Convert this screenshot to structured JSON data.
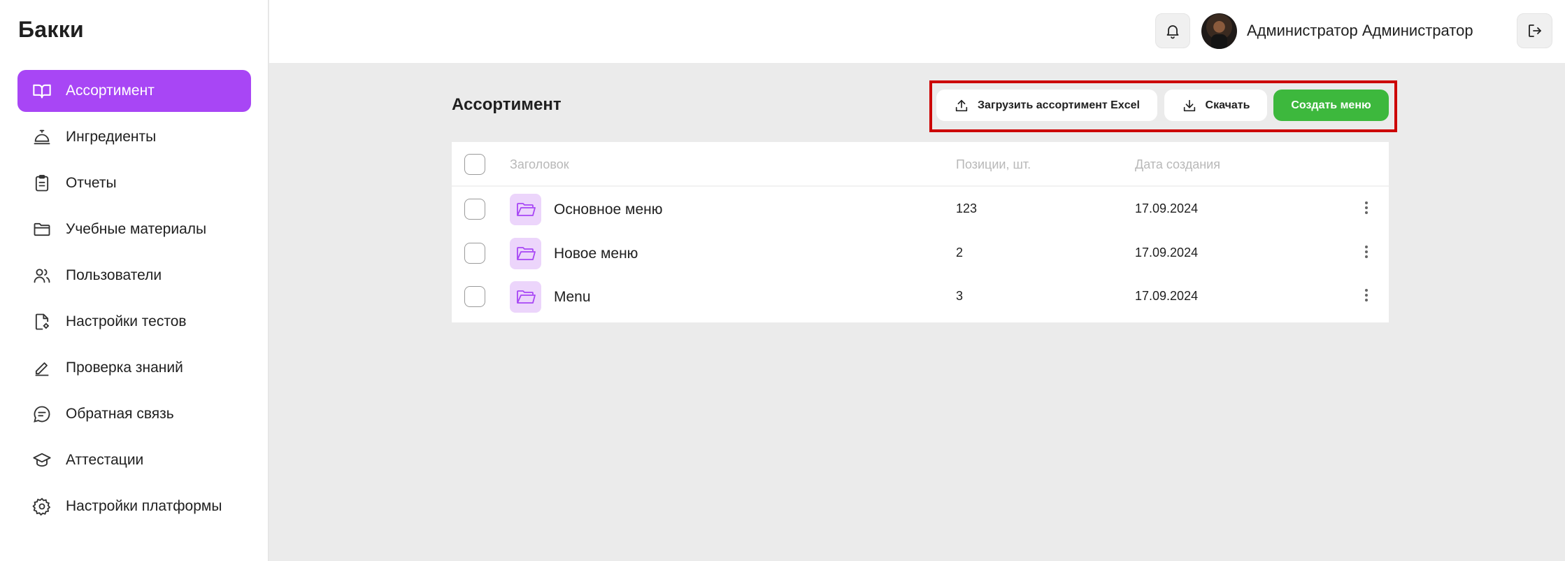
{
  "app": {
    "logo": "Бакки"
  },
  "sidebar": {
    "items": [
      {
        "label": "Ассортимент",
        "icon": "book-open-icon",
        "active": true
      },
      {
        "label": "Ингредиенты",
        "icon": "cloche-icon",
        "active": false
      },
      {
        "label": "Отчеты",
        "icon": "clipboard-icon",
        "active": false
      },
      {
        "label": "Учебные материалы",
        "icon": "folder-icon",
        "active": false
      },
      {
        "label": "Пользователи",
        "icon": "users-icon",
        "active": false
      },
      {
        "label": "Настройки тестов",
        "icon": "file-settings-icon",
        "active": false
      },
      {
        "label": "Проверка знаний",
        "icon": "pen-icon",
        "active": false
      },
      {
        "label": "Обратная связь",
        "icon": "chat-icon",
        "active": false
      },
      {
        "label": "Аттестации",
        "icon": "graduation-cap-icon",
        "active": false
      },
      {
        "label": "Настройки платформы",
        "icon": "gear-icon",
        "active": false
      }
    ]
  },
  "header": {
    "user_name": "Администратор Администратор",
    "bell_icon": "bell-icon",
    "logout_icon": "logout-icon"
  },
  "main": {
    "title": "Ассортимент",
    "actions": {
      "upload_label": "Загрузить ассортимент Excel",
      "download_label": "Скачать",
      "create_label": "Создать меню"
    },
    "table": {
      "columns": [
        "Заголовок",
        "Позиции, шт.",
        "Дата создания"
      ],
      "rows": [
        {
          "title": "Основное меню",
          "positions": "123",
          "date": "17.09.2024"
        },
        {
          "title": "Новое меню",
          "positions": "2",
          "date": "17.09.2024"
        },
        {
          "title": "Menu",
          "positions": "3",
          "date": "17.09.2024"
        }
      ]
    }
  },
  "colors": {
    "accent": "#a846f5",
    "create_button": "#3db83d",
    "highlight_frame": "#cc0000",
    "folder_bg": "#ecd5fb",
    "folder_icon": "#a846f5"
  }
}
